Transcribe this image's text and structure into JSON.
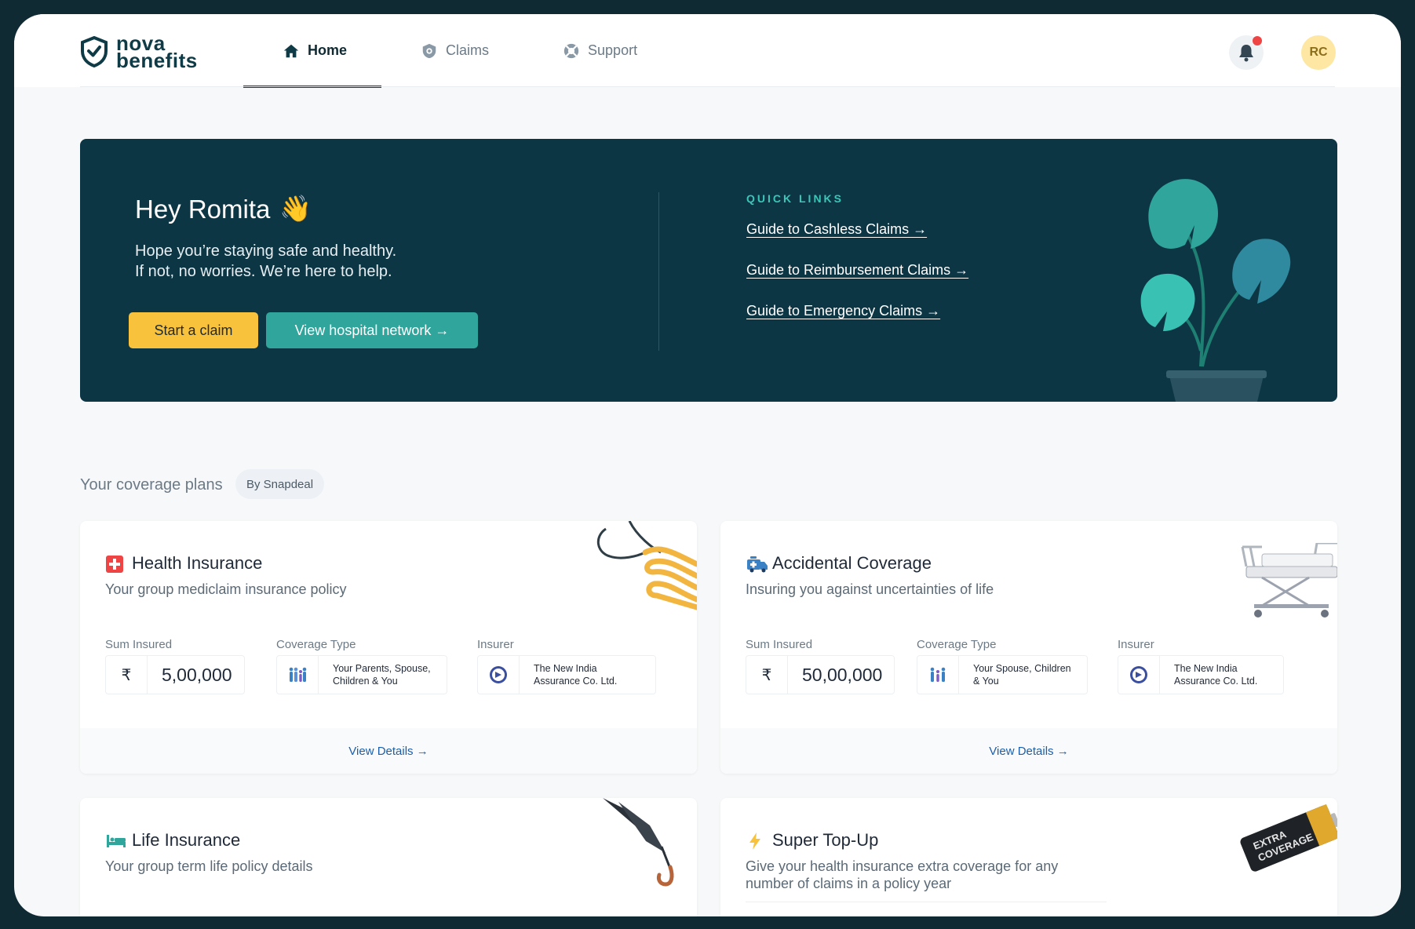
{
  "brand": {
    "line1": "nova",
    "line2": "benefits"
  },
  "nav": {
    "items": [
      {
        "label": "Home",
        "icon": "home-icon",
        "active": true
      },
      {
        "label": "Claims",
        "icon": "shield-icon",
        "active": false
      },
      {
        "label": "Support",
        "icon": "lifebuoy-icon",
        "active": false
      }
    ]
  },
  "header": {
    "avatar_initials": "RC",
    "notification_dot_color": "#ef4444"
  },
  "hero": {
    "greeting": "Hey Romita",
    "emoji": "👋",
    "line1": "Hope you’re staying safe and healthy.",
    "line2": "If not, no worries. We’re here to help.",
    "primary_button": "Start a claim",
    "secondary_button": "View hospital network →",
    "quick_links_title": "QUICK LINKS",
    "quick_links": [
      "Guide to Cashless Claims →",
      "Guide to Reimbursement Claims  →",
      "Guide to Emergency Claims  →"
    ]
  },
  "coverage": {
    "title": "Your coverage plans",
    "sponsor": "By Snapdeal",
    "labels": {
      "sum": "Sum Insured",
      "type": "Coverage Type",
      "insurer": "Insurer"
    },
    "cards": [
      {
        "title": "Health Insurance",
        "subtitle": "Your group mediclaim insurance policy",
        "currency": "₹",
        "sum_insured": "5,00,000",
        "coverage_line1": "Your Parents, Spouse,",
        "coverage_line2": "Children & You",
        "insurer_line1": "The New India",
        "insurer_line2": "Assurance Co. Ltd.",
        "details": "View Details →"
      },
      {
        "title": "Accidental Coverage",
        "subtitle": "Insuring you against uncertainties of life",
        "currency": "₹",
        "sum_insured": "50,00,000",
        "coverage_line1": "Your Spouse, Children",
        "coverage_line2": "& You",
        "insurer_line1": "The New India",
        "insurer_line2": "Assurance Co. Ltd.",
        "details": "View Details →"
      },
      {
        "title": "Life Insurance",
        "subtitle": "Your group term life policy details"
      },
      {
        "title": "Super Top-Up",
        "subtitle_line1": "Give your health insurance extra coverage for any",
        "subtitle_line2": "number of claims in a policy year",
        "battery_text_1": "EXTRA",
        "battery_text_2": "COVERAGE"
      }
    ]
  },
  "colors": {
    "hero_bg": "#0d3645",
    "yellow": "#f8c23d",
    "teal": "#2fa59c",
    "link_blue": "#1d5ea8"
  }
}
